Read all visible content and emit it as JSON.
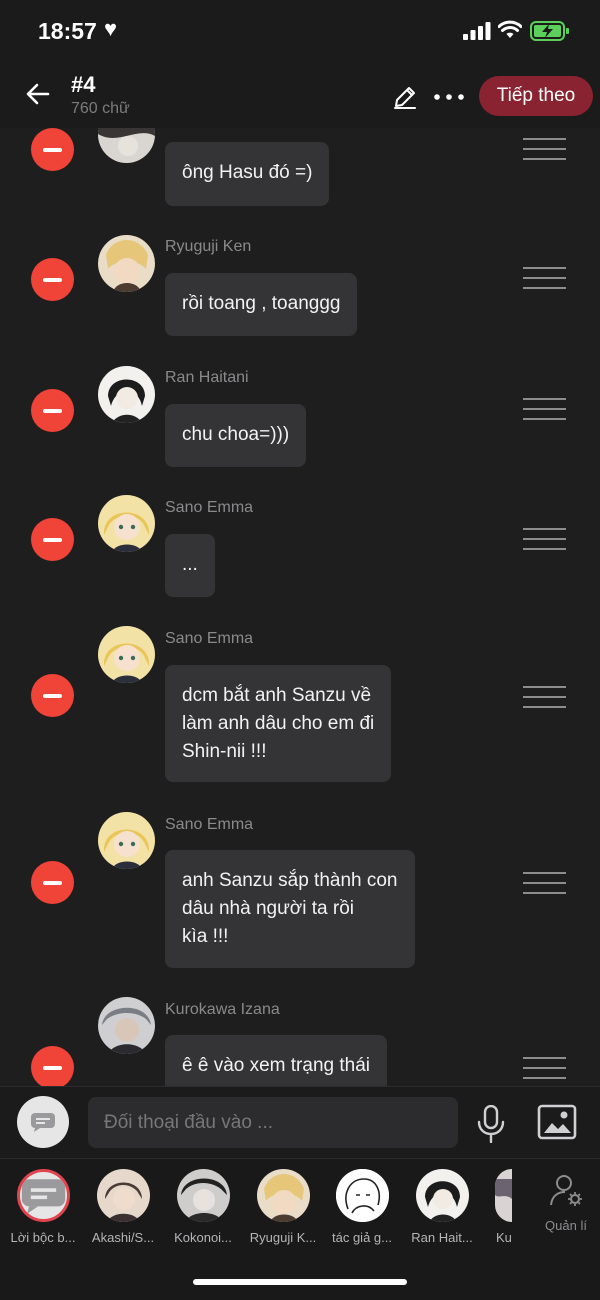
{
  "status": {
    "time": "18:57"
  },
  "header": {
    "title": "#4",
    "subtitle": "760 chữ",
    "next_label": "Tiếp theo"
  },
  "messages": [
    {
      "speaker": "",
      "text": "ông Hasu đó =)"
    },
    {
      "speaker": "Ryuguji Ken",
      "text": "rồi toang , toanggg"
    },
    {
      "speaker": "Ran Haitani",
      "text": "chu choa=)))"
    },
    {
      "speaker": "Sano Emma",
      "text": "..."
    },
    {
      "speaker": "Sano Emma",
      "text_lines": [
        "dcm bắt anh Sanzu về",
        "làm anh dâu cho em đi",
        "Shin-nii !!!"
      ]
    },
    {
      "speaker": "Sano Emma",
      "text_lines": [
        "anh Sanzu sắp thành con",
        "dâu nhà người ta rồi",
        "kìa !!!"
      ]
    },
    {
      "speaker": "Kurokawa Izana",
      "text_lines": [
        "ê ê vào xem trạng thái"
      ]
    }
  ],
  "composer": {
    "placeholder": "Đối thoại đầu vào ..."
  },
  "characters": [
    {
      "name": "Lời bộc b..."
    },
    {
      "name": "Akashi/S..."
    },
    {
      "name": "Kokonoi..."
    },
    {
      "name": "Ryuguji K..."
    },
    {
      "name": "tác giả g..."
    },
    {
      "name": "Ran Hait..."
    },
    {
      "name": "Ku"
    }
  ],
  "manage_label": "Quản lí",
  "colors": {
    "accent": "#8a2331",
    "delete": "#f04438",
    "bubble": "#343436",
    "background": "#1e1e1f"
  }
}
